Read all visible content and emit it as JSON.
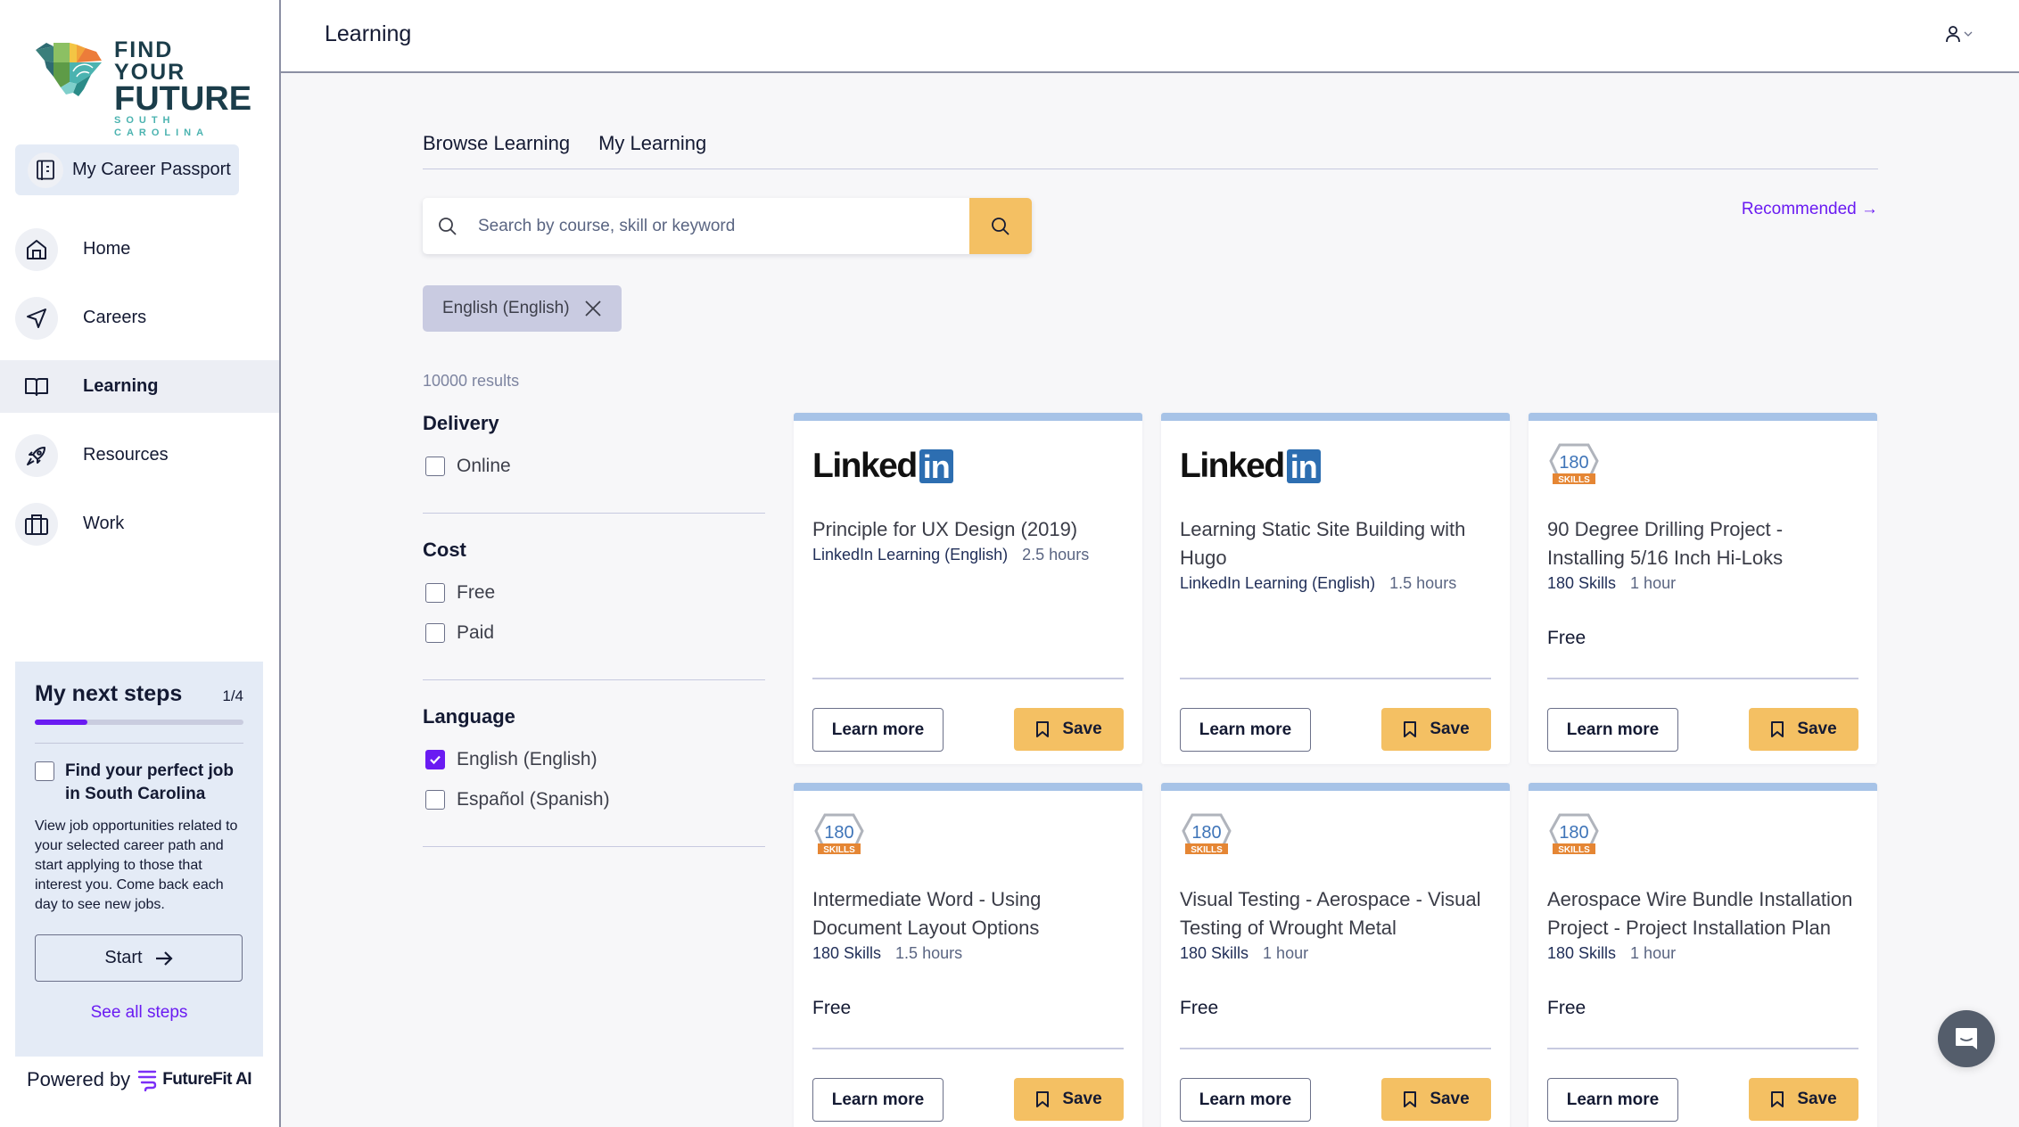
{
  "brand": {
    "line1": "FIND YOUR",
    "line2": "FUTURE",
    "line3": "SOUTH CAROLINA"
  },
  "sidebar": {
    "passport_label": "My Career Passport",
    "items": [
      {
        "label": "Home",
        "icon": "home-icon",
        "active": false
      },
      {
        "label": "Careers",
        "icon": "navigation-arrow-icon",
        "active": false
      },
      {
        "label": "Learning",
        "icon": "book-icon",
        "active": true
      },
      {
        "label": "Resources",
        "icon": "rocket-icon",
        "active": false
      },
      {
        "label": "Work",
        "icon": "briefcase-icon",
        "active": false
      }
    ],
    "next_steps": {
      "title": "My next steps",
      "count": "1/4",
      "progress": 0.25,
      "step_title": "Find your perfect job in South Carolina",
      "step_desc": "View job opportunities related to your selected career path and start applying to those that interest you. Come back each day to see new jobs.",
      "start_label": "Start",
      "see_all_label": "See all steps"
    },
    "powered_by": "Powered by",
    "powered_brand": "FutureFit AI"
  },
  "header": {
    "title": "Learning"
  },
  "tabs": [
    {
      "label": "Browse Learning"
    },
    {
      "label": "My Learning"
    }
  ],
  "search": {
    "placeholder": "Search by course, skill or keyword",
    "value": ""
  },
  "recommended_label": "Recommended →",
  "active_filter_chip": "English (English)",
  "results_count": "10000 results",
  "filters": [
    {
      "heading": "Delivery",
      "options": [
        {
          "label": "Online",
          "checked": false
        }
      ]
    },
    {
      "heading": "Cost",
      "options": [
        {
          "label": "Free",
          "checked": false
        },
        {
          "label": "Paid",
          "checked": false
        }
      ]
    },
    {
      "heading": "Language",
      "options": [
        {
          "label": "English (English)",
          "checked": true
        },
        {
          "label": "Español (Spanish)",
          "checked": false
        }
      ]
    }
  ],
  "cards": [
    {
      "logo": "linkedin",
      "title": "Principle for UX Design (2019)",
      "provider": "LinkedIn Learning (English)",
      "duration": "2.5 hours",
      "price": ""
    },
    {
      "logo": "linkedin",
      "title": "Learning Static Site Building with Hugo",
      "provider": "LinkedIn Learning (English)",
      "duration": "1.5 hours",
      "price": ""
    },
    {
      "logo": "180skills",
      "title": "90 Degree Drilling Project - Installing 5/16 Inch Hi-Loks",
      "provider": "180 Skills",
      "duration": "1 hour",
      "price": "Free"
    },
    {
      "logo": "180skills",
      "title": "Intermediate Word - Using Document Layout Options",
      "provider": "180 Skills",
      "duration": "1.5 hours",
      "price": "Free"
    },
    {
      "logo": "180skills",
      "title": "Visual Testing - Aerospace - Visual Testing of Wrought Metal",
      "provider": "180 Skills",
      "duration": "1 hour",
      "price": "Free"
    },
    {
      "logo": "180skills",
      "title": "Aerospace Wire Bundle Installation Project - Project Installation Plan",
      "provider": "180 Skills",
      "duration": "1 hour",
      "price": "Free"
    }
  ],
  "card_labels": {
    "learn_more": "Learn more",
    "save": "Save",
    "linkedin_word": "Linked",
    "linkedin_in": "in",
    "skills_num": "180",
    "skills_word": "SKILLS"
  },
  "colors": {
    "accent": "#6a1bf2",
    "save_button": "#f4c063",
    "card_top_bar": "#a7c3e7",
    "chip_bg": "#c9cbe1"
  }
}
